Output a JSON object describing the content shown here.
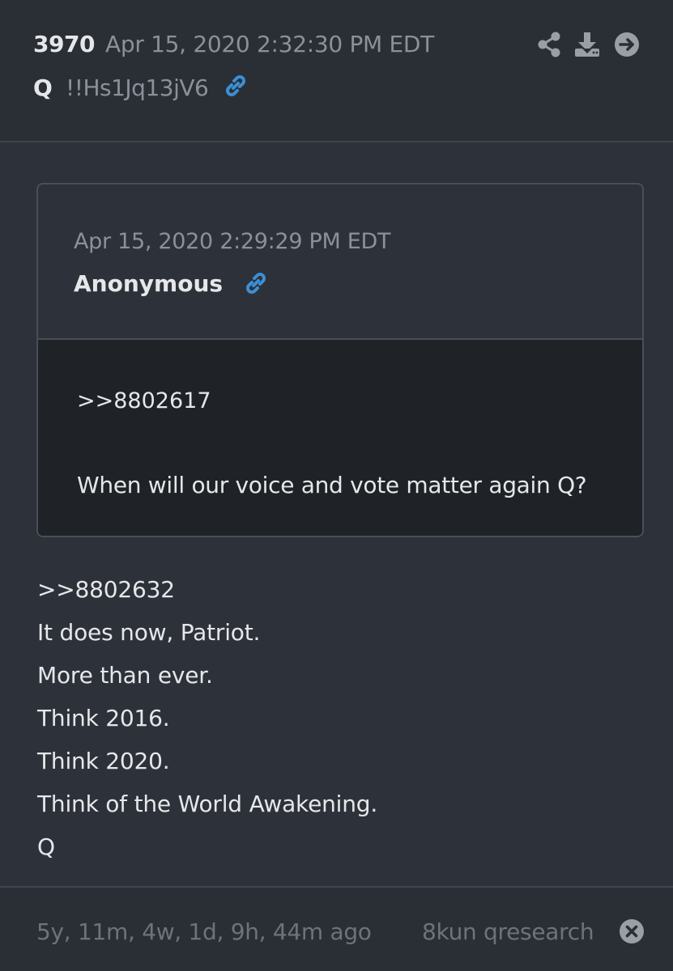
{
  "post": {
    "number": "3970",
    "date": "Apr 15, 2020 2:32:30 PM EDT",
    "author": "Q",
    "tripcode": "!!Hs1Jq13jV6"
  },
  "quote": {
    "date": "Apr 15, 2020 2:29:29 PM EDT",
    "author": "Anonymous",
    "reference": ">>8802617",
    "text": "When will our voice and vote matter again Q?"
  },
  "message": {
    "lines": [
      ">>8802632",
      "It does now, Patriot.",
      "More than ever.",
      "Think 2016.",
      "Think 2020.",
      "Think of the World Awakening.",
      "Q"
    ]
  },
  "footer": {
    "elapsed": "5y, 11m, 4w, 1d, 9h, 44m ago",
    "source": "8kun qresearch"
  },
  "icons": {
    "share": "share-icon",
    "download": "download-icon",
    "goto": "arrow-right-circle-icon",
    "link": "link-icon",
    "close": "close-circle-icon"
  },
  "colors": {
    "background": "#2d323a",
    "header_background": "#2a2f36",
    "quote_body_background": "#1f2226",
    "text": "#e6e7e9",
    "muted_text": "#8b9099",
    "link_accent": "#3b8fd6",
    "icon_gray": "#9a9ea5"
  }
}
